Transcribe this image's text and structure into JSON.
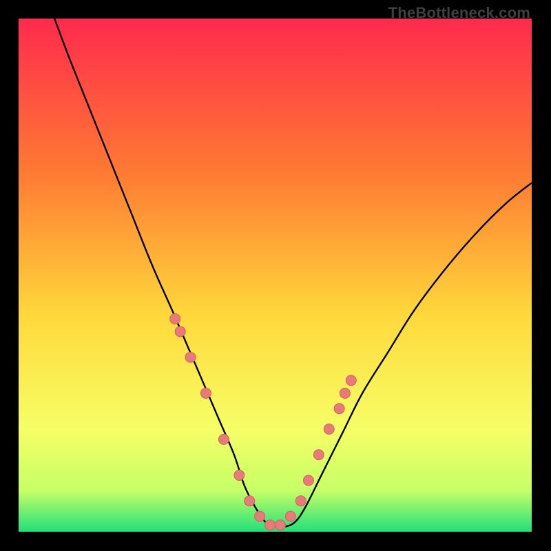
{
  "watermark": "TheBottleneck.com",
  "colors": {
    "gradient_top": "#ff2a4d",
    "gradient_mid1": "#ff7a33",
    "gradient_mid2": "#ffd93b",
    "gradient_mid3": "#f6ff66",
    "gradient_mid4": "#c6ff66",
    "gradient_bottom": "#21e07a",
    "curve": "#000000",
    "marker_fill": "#e67b79",
    "marker_stroke": "#d85f5d",
    "frame_bg": "#000000"
  },
  "chart_data": {
    "type": "line",
    "title": "",
    "xlabel": "",
    "ylabel": "",
    "xlim": [
      0,
      100
    ],
    "ylim": [
      0,
      100
    ],
    "series": [
      {
        "name": "bottleneck-curve",
        "x": [
          7,
          10,
          14,
          18,
          22,
          26,
          30,
          33,
          36,
          39,
          42,
          44,
          46,
          48,
          50,
          52,
          54,
          56,
          59,
          63,
          67,
          72,
          77,
          83,
          89,
          95,
          100
        ],
        "y": [
          100,
          92,
          82,
          72,
          62,
          52,
          43,
          36,
          29,
          22,
          15,
          9,
          5,
          2,
          1,
          1,
          2,
          5,
          11,
          19,
          27,
          35,
          43,
          51,
          58,
          64,
          68
        ]
      }
    ],
    "markers": {
      "name": "highlight-dots",
      "x": [
        30.5,
        31.5,
        33.5,
        36.5,
        40.0,
        43.0,
        45.0,
        47.0,
        49.0,
        51.0,
        53.0,
        55.0,
        56.5,
        58.5,
        60.5,
        62.5,
        63.6,
        64.8
      ],
      "y": [
        41.5,
        39.0,
        34.0,
        27.0,
        18.0,
        11.0,
        6.0,
        3.0,
        1.3,
        1.3,
        3.0,
        6.0,
        10.0,
        15.0,
        20.0,
        24.0,
        27.0,
        29.5
      ]
    },
    "annotations": []
  }
}
